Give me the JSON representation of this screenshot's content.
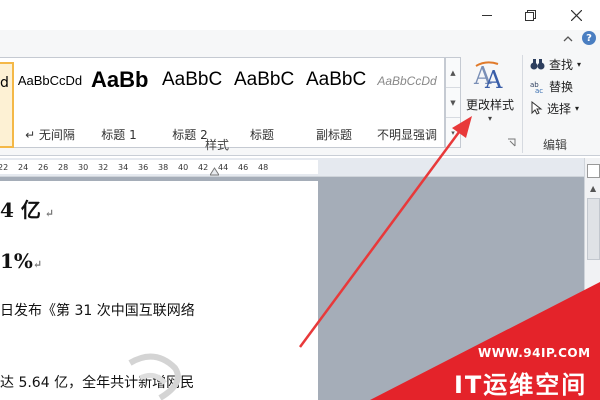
{
  "window": {
    "minimize_symbol": "—",
    "restore_symbol": "⧉",
    "close_symbol": "✕",
    "help_symbol": "?",
    "collapse_symbol": "⌃"
  },
  "styles_gallery": {
    "items": [
      {
        "preview": "d",
        "name": ""
      },
      {
        "preview": "AaBbCcDd",
        "name": "↵ 无间隔"
      },
      {
        "preview": "AaBb",
        "name": "标题 1"
      },
      {
        "preview": "AaBbC",
        "name": "标题 2"
      },
      {
        "preview": "AaBbC",
        "name": "标题"
      },
      {
        "preview": "AaBbC",
        "name": "副标题"
      },
      {
        "preview": "AaBbCcDd",
        "name": "不明显强调"
      }
    ],
    "group_label": "样式",
    "change_styles_label": "更改样式"
  },
  "editing": {
    "find_label": "查找",
    "replace_label": "替换",
    "select_label": "选择",
    "group_label": "编辑"
  },
  "ruler": {
    "ticks": [
      "22",
      "24",
      "26",
      "28",
      "30",
      "32",
      "34",
      "36",
      "38",
      "40",
      "42",
      "44",
      "46",
      "48"
    ]
  },
  "document": {
    "line1": "4 亿",
    "line2": "1%",
    "line3": "日发布《第 31 次中国互联网络",
    "line4": "达 5.64 亿，全年共计新增网民"
  },
  "watermark": {
    "url": "WWW.94IP.COM",
    "text": "IT运维空间"
  },
  "colors": {
    "accent_orange": "#f4b847",
    "arrow_red": "#e8393a",
    "watermark_red": "#e4232a"
  }
}
